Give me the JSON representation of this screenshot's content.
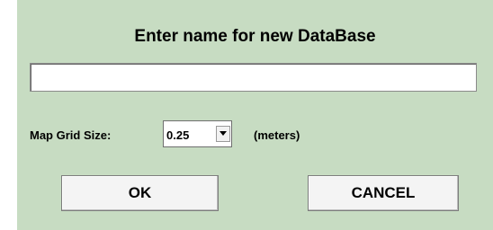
{
  "dialog": {
    "title": "Enter name for new DataBase",
    "name_input": {
      "value": "",
      "placeholder": ""
    },
    "grid_size": {
      "label": "Map Grid Size:",
      "selected": "0.25",
      "units": "(meters)"
    },
    "buttons": {
      "ok": "OK",
      "cancel": "CANCEL"
    }
  },
  "colors": {
    "dialog_background": "#c7dcc2",
    "button_background": "#f4f4f4"
  },
  "icons": {
    "dropdown": "chevron-down-icon"
  }
}
